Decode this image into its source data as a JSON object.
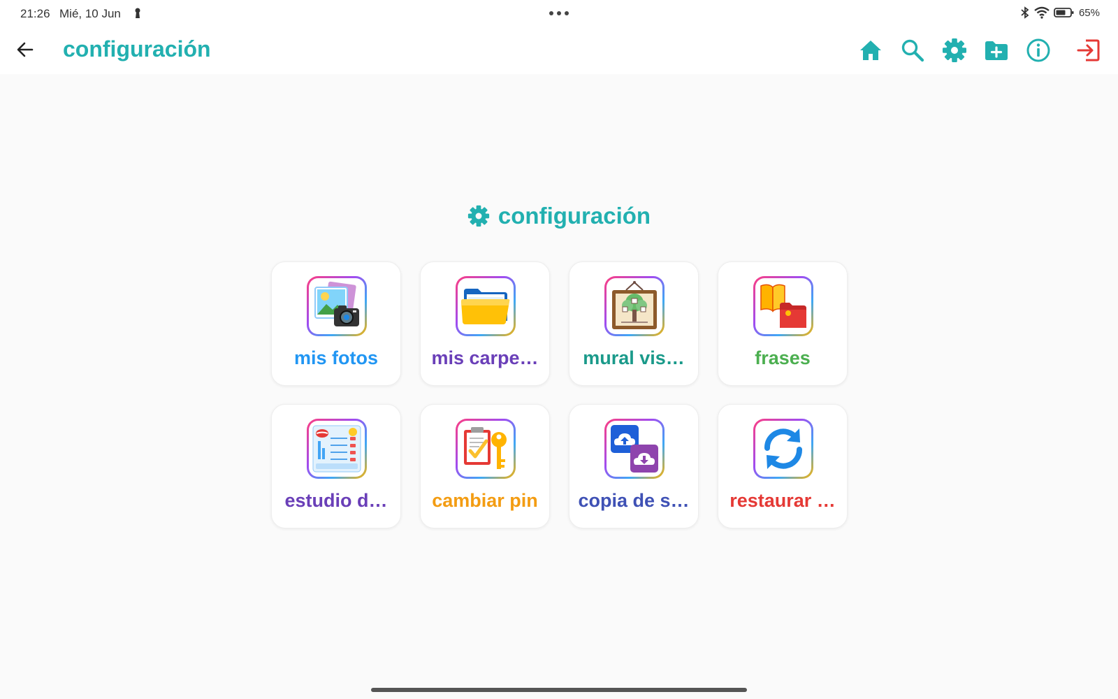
{
  "status_bar": {
    "time": "21:26",
    "date": "Mié, 10 Jun",
    "battery": "65%"
  },
  "app_bar": {
    "title": "configuración",
    "actions": [
      {
        "name": "home-icon",
        "color": "#22b0b0"
      },
      {
        "name": "search-icon",
        "color": "#22b0b0"
      },
      {
        "name": "gear-icon",
        "color": "#22b0b0"
      },
      {
        "name": "folder-add-icon",
        "color": "#22b0b0"
      },
      {
        "name": "info-icon",
        "color": "#22b0b0"
      },
      {
        "name": "logout-icon",
        "color": "#e53935"
      }
    ]
  },
  "section": {
    "heading": "configuración",
    "heading_icon": "gear-icon"
  },
  "tiles": [
    {
      "label": "mis fotos",
      "color": "#2196f3",
      "icon": "photos-camera-icon"
    },
    {
      "label": "mis carpe…",
      "color": "#6a3fb8",
      "icon": "folder-icon"
    },
    {
      "label": "mural vis…",
      "color": "#1a9a8a",
      "icon": "visual-board-icon"
    },
    {
      "label": "frases",
      "color": "#4caf50",
      "icon": "book-folder-icon"
    },
    {
      "label": "estudio d…",
      "color": "#6a3fb8",
      "icon": "speech-study-icon"
    },
    {
      "label": "cambiar pin",
      "color": "#f39c12",
      "icon": "clipboard-key-icon"
    },
    {
      "label": "copia de s…",
      "color": "#3f51b5",
      "icon": "cloud-backup-icon"
    },
    {
      "label": "restaurar …",
      "color": "#e53935",
      "icon": "sync-icon"
    }
  ],
  "colors": {
    "accent": "#22b0b0",
    "background": "#fafafa",
    "danger": "#e53935"
  }
}
